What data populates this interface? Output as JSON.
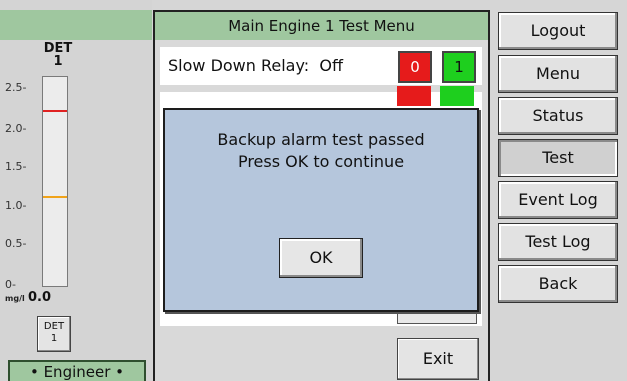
{
  "detector": {
    "title_line1": "DET",
    "title_line2": "1",
    "scale_ticks": [
      "2.5-",
      "2.0-",
      "1.5-",
      "1.0-",
      "0.5-",
      "0-"
    ],
    "unit": "mg/l",
    "reading": "0.0",
    "button_line1": "DET",
    "button_line2": "1",
    "level_fraction": 0.0,
    "colors": {
      "high_limit": "#e02222",
      "warning_limit": "#f0a31a"
    }
  },
  "role_badge": "• Engineer •",
  "test_menu": {
    "title": "Main Engine 1 Test Menu",
    "row1": {
      "label": "Slow Down Relay:  Off",
      "off_button": "0",
      "on_button": "1"
    },
    "exit_label": "Exit"
  },
  "nav": {
    "items": [
      {
        "label": "Logout",
        "active": false
      },
      {
        "label": "Menu",
        "active": false
      },
      {
        "label": "Status",
        "active": false
      },
      {
        "label": "Test",
        "active": true
      },
      {
        "label": "Event Log",
        "active": false
      },
      {
        "label": "Test Log",
        "active": false
      },
      {
        "label": "Back",
        "active": false
      }
    ]
  },
  "dialog": {
    "line1": "Backup alarm test passed",
    "line2": "Press OK to continue",
    "ok_label": "OK"
  },
  "colors": {
    "header_green": "#9fc79f",
    "dialog_blue": "#b5c6dc",
    "relay_off_red": "#e61b1b",
    "relay_on_green": "#1ecf1e"
  }
}
